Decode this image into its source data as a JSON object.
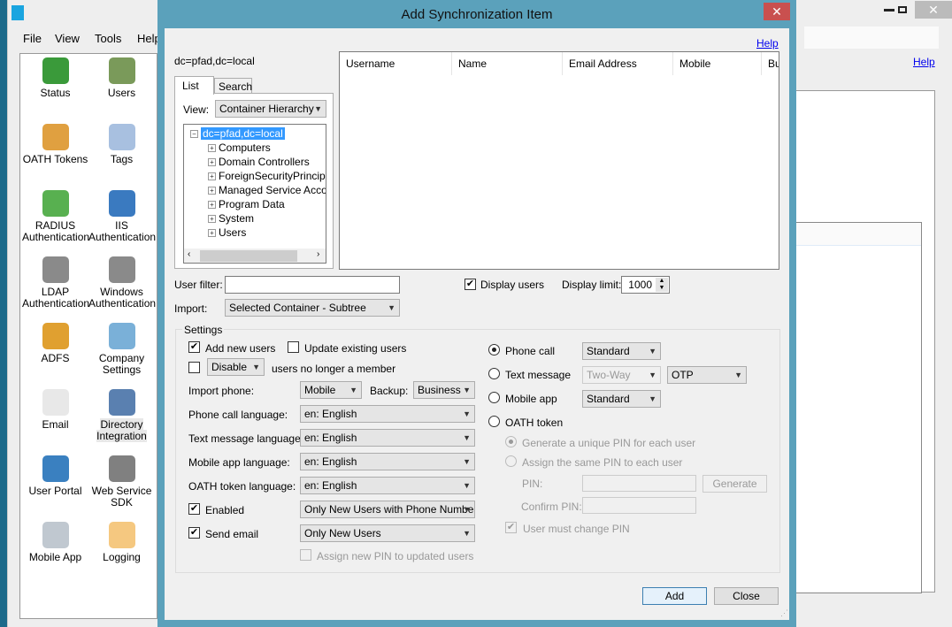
{
  "main_window": {
    "menu": [
      "File",
      "View",
      "Tools",
      "Help"
    ],
    "help_link": "Help",
    "controls": {
      "minimize": "minimize-icon",
      "maximize": "maximize-icon",
      "close": "close-icon"
    },
    "nav_items": [
      {
        "label": "Status",
        "icon": "status-icon",
        "color": "#3a9a3a"
      },
      {
        "label": "Users",
        "icon": "users-icon",
        "color": "#7a9a5a"
      },
      {
        "label": "OATH Tokens",
        "icon": "key-icon",
        "color": "#e0a040"
      },
      {
        "label": "Tags",
        "icon": "tag-icon",
        "color": "#a8c0e0"
      },
      {
        "label": "RADIUS Authentication",
        "icon": "radius-icon",
        "color": "#58b050"
      },
      {
        "label": "IIS Authentication",
        "icon": "iis-icon",
        "color": "#3a7ac0"
      },
      {
        "label": "LDAP Authentication",
        "icon": "ldap-icon",
        "color": "#8a8a8a"
      },
      {
        "label": "Windows Authentication",
        "icon": "windows-auth-icon",
        "color": "#8a8a8a"
      },
      {
        "label": "ADFS",
        "icon": "adfs-icon",
        "color": "#e0a030"
      },
      {
        "label": "Company Settings",
        "icon": "gear-icon",
        "color": "#7ab0d8"
      },
      {
        "label": "Email",
        "icon": "envelope-icon",
        "color": "#e8e8e8"
      },
      {
        "label": "Directory Integration",
        "icon": "directory-icon",
        "color": "#5a80b0"
      },
      {
        "label": "User Portal",
        "icon": "globe-user-icon",
        "color": "#3a80c0"
      },
      {
        "label": "Web Service SDK",
        "icon": "sdk-icon",
        "color": "#808080"
      },
      {
        "label": "Mobile App",
        "icon": "phone-icon",
        "color": "#c0c8d0"
      },
      {
        "label": "Logging",
        "icon": "speech-bubble-icon",
        "color": "#f5c880"
      }
    ]
  },
  "dialog": {
    "title": "Add Synchronization Item",
    "help_link": "Help",
    "container_path": "dc=pfad,dc=local",
    "tabs": [
      "List",
      "Search"
    ],
    "view_label": "View:",
    "view_value": "Container Hierarchy",
    "tree": {
      "root": "dc=pfad,dc=local",
      "children": [
        "Computers",
        "Domain Controllers",
        "ForeignSecurityPrincipals",
        "Managed Service Accou",
        "Program Data",
        "System",
        "Users"
      ]
    },
    "columns": [
      "Username",
      "Name",
      "Email Address",
      "Mobile",
      "Bu"
    ],
    "user_filter_label": "User filter:",
    "user_filter_value": "",
    "display_users_label": "Display users",
    "display_users_checked": true,
    "display_limit_label": "Display limit:",
    "display_limit": "1000",
    "import_label": "Import:",
    "import_value": "Selected Container - Subtree",
    "settings": {
      "group_label": "Settings",
      "add_new_users": {
        "label": "Add new users",
        "checked": true
      },
      "update_existing": {
        "label": "Update existing users",
        "checked": false
      },
      "disable_check": false,
      "disable_value": "Disable",
      "no_longer_member": "users no longer a member",
      "import_phone_label": "Import phone:",
      "import_phone": "Mobile",
      "backup_label": "Backup:",
      "backup": "Business",
      "phone_call_language_label": "Phone call language:",
      "phone_call_language": "en: English",
      "text_message_language_label": "Text message language:",
      "text_message_language": "en: English",
      "mobile_app_language_label": "Mobile app language:",
      "mobile_app_language": "en: English",
      "oath_language_label": "OATH token language:",
      "oath_language": "en: English",
      "enabled": {
        "label": "Enabled",
        "checked": true,
        "value": "Only New Users with Phone Number"
      },
      "send_email": {
        "label": "Send email",
        "checked": true,
        "value": "Only New Users"
      },
      "assign_new_pin": {
        "label": "Assign new PIN to updated users",
        "checked": false
      },
      "methods": {
        "phone_call": {
          "label": "Phone call",
          "selected": true,
          "mode": "Standard"
        },
        "text_message": {
          "label": "Text message",
          "selected": false,
          "mode": "Two-Way",
          "otp": "OTP"
        },
        "mobile_app": {
          "label": "Mobile app",
          "selected": false,
          "mode": "Standard"
        },
        "oath_token": {
          "label": "OATH token",
          "selected": false
        }
      },
      "pin_unique": "Generate a unique PIN for each user",
      "pin_same": "Assign the same PIN to each user",
      "pin_label": "PIN:",
      "confirm_pin_label": "Confirm PIN:",
      "generate": "Generate",
      "must_change_pin": {
        "label": "User must change PIN",
        "checked": true
      }
    },
    "add_button": "Add",
    "close_button": "Close"
  }
}
